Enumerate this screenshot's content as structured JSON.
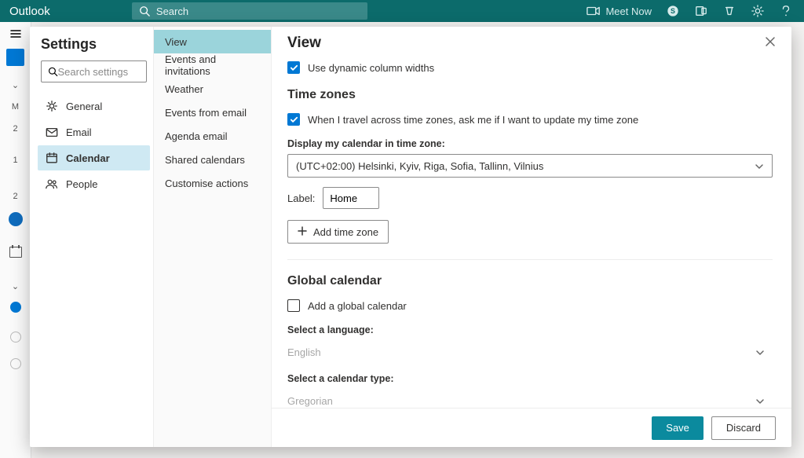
{
  "topbar": {
    "product": "Outlook",
    "search_placeholder": "Search",
    "meet_now": "Meet Now"
  },
  "settings": {
    "title": "Settings",
    "search_placeholder": "Search settings",
    "cats": [
      {
        "label": "General"
      },
      {
        "label": "Email"
      },
      {
        "label": "Calendar"
      },
      {
        "label": "People"
      }
    ],
    "subitems": [
      {
        "label": "View"
      },
      {
        "label": "Events and invitations"
      },
      {
        "label": "Weather"
      },
      {
        "label": "Events from email"
      },
      {
        "label": "Agenda email"
      },
      {
        "label": "Shared calendars"
      },
      {
        "label": "Customise actions"
      }
    ]
  },
  "panel": {
    "title": "View",
    "dyn_widths": "Use dynamic column widths",
    "sect_timezones": "Time zones",
    "tz_travel": "When I travel across time zones, ask me if I want to update my time zone",
    "tz_display_lbl": "Display my calendar in time zone:",
    "tz_value": "(UTC+02:00) Helsinki, Kyiv, Riga, Sofia, Tallinn, Vilnius",
    "tz_label_lbl": "Label:",
    "tz_label_value": "Home",
    "tz_add": "Add time zone",
    "sect_global": "Global calendar",
    "global_add": "Add a global calendar",
    "global_lang_lbl": "Select a language:",
    "global_lang_value": "English",
    "global_type_lbl": "Select a calendar type:",
    "global_type_value": "Gregorian"
  },
  "footer": {
    "save": "Save",
    "discard": "Discard"
  },
  "colors": {
    "brand": "#0c6b6b",
    "accent": "#0078d4"
  }
}
